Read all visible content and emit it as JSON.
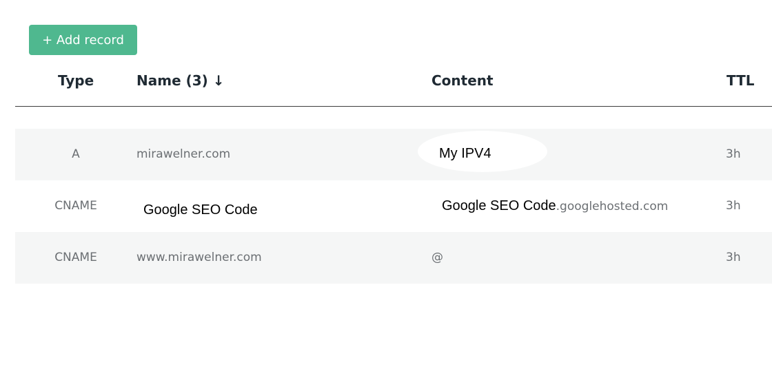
{
  "toolbar": {
    "add_record_label": "+ Add record"
  },
  "table": {
    "headers": {
      "type": "Type",
      "name": "Name (3) ↓",
      "content": "Content",
      "ttl": "TTL"
    },
    "rows": [
      {
        "type": "A",
        "name": "mirawelner.com",
        "content": "My IPV4",
        "ttl": "3h"
      },
      {
        "type": "CNAME",
        "name": "Google SEO Code",
        "content_prefix": "Google SEO Code",
        "content": ".googlehosted.com",
        "ttl": "3h"
      },
      {
        "type": "CNAME",
        "name": "www.mirawelner.com",
        "content": "@",
        "ttl": "3h"
      }
    ]
  },
  "colors": {
    "accent": "#4fb88f",
    "row_alt": "#f5f6f6",
    "header_text": "#1f2a33",
    "cell_text": "#6b6f73"
  }
}
